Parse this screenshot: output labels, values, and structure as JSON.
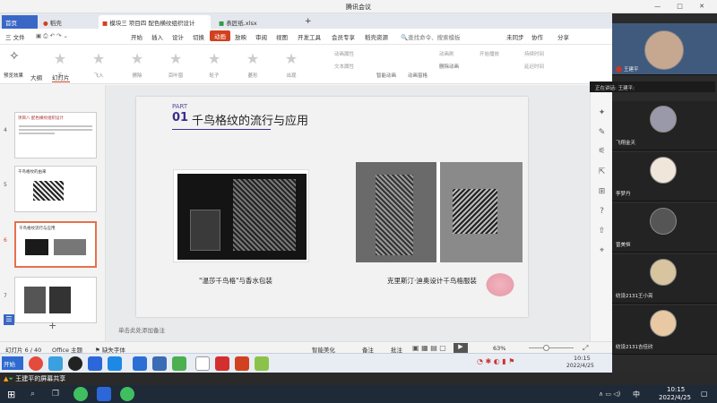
{
  "meeting": {
    "title": "腾讯会议",
    "speaking": "正在讲话: 王建平;"
  },
  "tabs": [
    {
      "label": "首页"
    },
    {
      "label": "稻壳"
    },
    {
      "label": "模块三 项目四 配色横纹组织设计"
    },
    {
      "label": "表匠纸.xlsx"
    }
  ],
  "menu": {
    "file": "三 文件",
    "items": [
      "开始",
      "插入",
      "设计",
      "切换",
      "动画",
      "放映",
      "审阅",
      "视图",
      "开发工具",
      "会员专享",
      "稻壳资源"
    ],
    "search": "查找命令、搜索模板",
    "unsync": "未同步",
    "collab": "协作",
    "share": "分享"
  },
  "toolbar": {
    "preview": "预览效果",
    "effects": [
      "无",
      "飞入",
      "擦除",
      "百叶窗",
      "轮子",
      "菱形",
      "出现"
    ],
    "right": [
      "动画属性",
      "文本属性",
      "智能动画",
      "动画窗格",
      "删除动画",
      "动画刷",
      "开始播放",
      "持续时间",
      "延迟时间"
    ]
  },
  "left_pane": {
    "tab_outline": "大纲",
    "tab_slides": "幻灯片",
    "thumbs": [
      {
        "num": "4",
        "title": "项目八 配色横纹组织设计"
      },
      {
        "num": "5",
        "title": "千鸟格纹的由来"
      },
      {
        "num": "6",
        "title": "千鸟格纹流行与应用"
      },
      {
        "num": "7",
        "title": ""
      }
    ]
  },
  "slide": {
    "part": "PART",
    "num": "01",
    "title": "千鸟格纹的流行与应用",
    "caption_left": "\"温莎千鸟格\"与香水包装",
    "caption_right": "克里斯汀·迪奥设计千鸟格服装"
  },
  "notes_placeholder": "单击此处添加备注",
  "status": {
    "slide_pos": "幻灯片 6 / 40",
    "theme": "Office 主题",
    "font_missing": "缺失字体",
    "smart": "智能美化",
    "notes": "备注",
    "comment": "批注",
    "zoom": "63%"
  },
  "participants": [
    {
      "name": "王建平"
    },
    {
      "name": "飞翔金天"
    },
    {
      "name": "李梦丹"
    },
    {
      "name": "曾美恒"
    },
    {
      "name": "纺设2131王小亮"
    },
    {
      "name": "纺设2131吉佳欣"
    }
  ],
  "taskbar": {
    "start": "开始",
    "time": "10:15",
    "date": "2022/4/25",
    "screen_share": "王建平的屏幕共享",
    "sys_lang": "中",
    "sys_time": "10:15",
    "sys_date": "2022/4/25"
  },
  "colors": {
    "accent": "#d2411f",
    "wps_tab": "#e4e8ee",
    "taskbar": "#1f2a38"
  }
}
